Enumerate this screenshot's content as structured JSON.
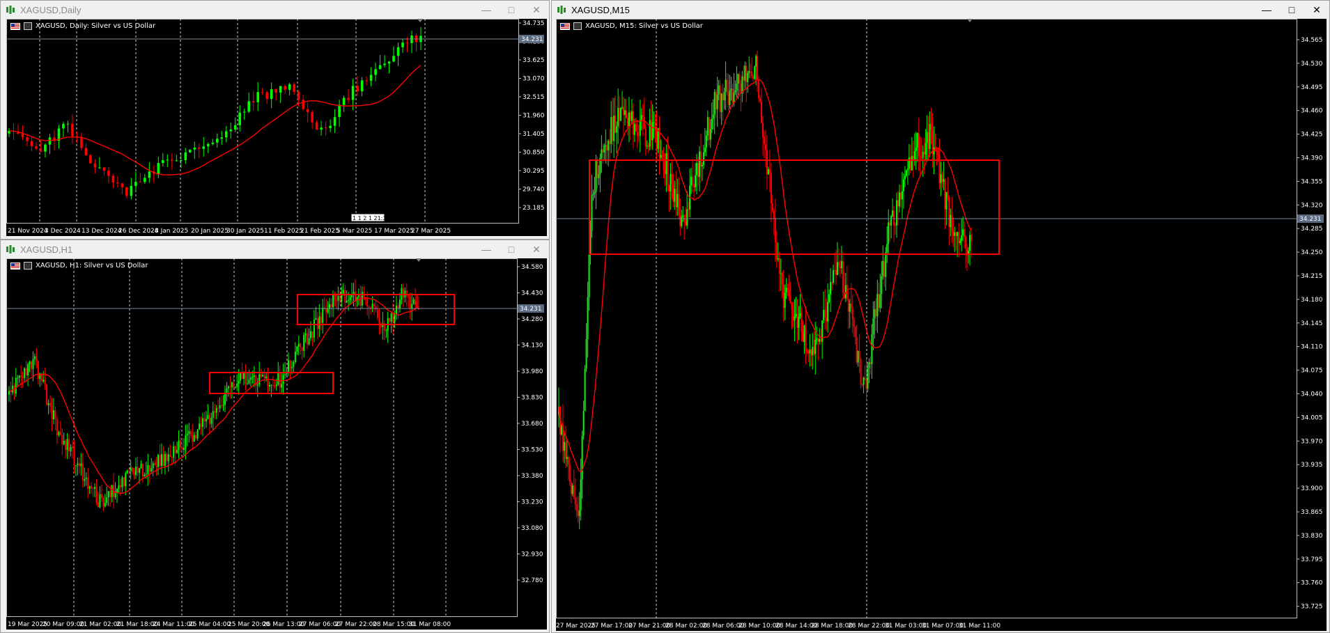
{
  "windows": {
    "daily": {
      "title": "XAGUSD,Daily",
      "legend": "XAGUSD, Daily:  Silver vs US Dollar",
      "current_price": "34.231",
      "counter_badge": "1 1 2 1 21:30",
      "price_ticks": [
        "34.735",
        "34.180",
        "33.625",
        "33.070",
        "32.515",
        "31.960",
        "31.405",
        "30.850",
        "30.295",
        "29.740",
        "23.185"
      ],
      "time_ticks": [
        "21 Nov 2024",
        "3 Dec 2024",
        "13 Dec 2024",
        "26 Dec 2024",
        "8 Jan 2025",
        "20 Jan 2025",
        "30 Jan 2025",
        "11 Feb 2025",
        "21 Feb 2025",
        "5 Mar 2025",
        "17 Mar 2025",
        "27 Mar 2025"
      ]
    },
    "h1": {
      "title": "XAGUSD,H1",
      "legend": "XAGUSD, H1:  Silver vs US Dollar",
      "current_price": "34.231",
      "price_ticks": [
        "34.580",
        "34.430",
        "34.280",
        "34.130",
        "33.980",
        "33.830",
        "33.680",
        "33.530",
        "33.380",
        "33.230",
        "33.080",
        "32.930",
        "32.780"
      ],
      "time_ticks": [
        "19 Mar 2025",
        "20 Mar 09:00",
        "21 Mar 02:00",
        "21 Mar 18:00",
        "24 Mar 11:00",
        "25 Mar 04:00",
        "25 Mar 20:00",
        "26 Mar 13:00",
        "27 Mar 06:00",
        "27 Mar 22:00",
        "28 Mar 15:00",
        "31 Mar 08:00"
      ]
    },
    "m15": {
      "title": "XAGUSD,M15",
      "legend": "XAGUSD, M15:  Silver vs US Dollar",
      "current_price": "34.231",
      "price_ticks": [
        "34.565",
        "34.530",
        "34.495",
        "34.460",
        "34.425",
        "34.390",
        "34.355",
        "34.320",
        "34.285",
        "34.250",
        "34.215",
        "34.180",
        "34.145",
        "34.110",
        "34.075",
        "34.040",
        "34.005",
        "33.970",
        "33.935",
        "33.900",
        "33.865",
        "33.830",
        "33.795",
        "33.760",
        "33.725"
      ],
      "time_ticks": [
        "27 Mar 2025",
        "27 Mar 17:00",
        "27 Mar 21:00",
        "28 Mar 02:00",
        "28 Mar 06:00",
        "28 Mar 10:00",
        "28 Mar 14:00",
        "28 Mar 18:00",
        "28 Mar 22:00",
        "31 Mar 03:00",
        "31 Mar 07:00",
        "31 Mar 11:00"
      ]
    }
  },
  "colors": {
    "bull": "#00ff00",
    "bear": "#ff0000",
    "ma": "#ff0000",
    "grid": "#ffffff",
    "box": "#ff0000",
    "price_line": "#778899"
  }
}
